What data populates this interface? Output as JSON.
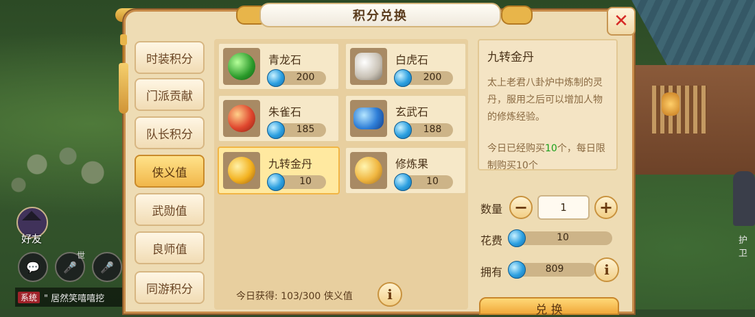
{
  "dialog": {
    "title": "积分兑换"
  },
  "tabs": [
    {
      "label": "时装积分",
      "active": false
    },
    {
      "label": "门派贡献",
      "active": false
    },
    {
      "label": "队长积分",
      "active": false
    },
    {
      "label": "侠义值",
      "active": true
    },
    {
      "label": "武勋值",
      "active": false
    },
    {
      "label": "良师值",
      "active": false
    },
    {
      "label": "同游积分",
      "active": false
    }
  ],
  "items": [
    {
      "name": "青龙石",
      "price": "200",
      "icon": "green-dragon-stone-icon",
      "selected": false
    },
    {
      "name": "白虎石",
      "price": "200",
      "icon": "white-tiger-stone-icon",
      "selected": false
    },
    {
      "name": "朱雀石",
      "price": "185",
      "icon": "vermilion-bird-stone-icon",
      "selected": false
    },
    {
      "name": "玄武石",
      "price": "188",
      "icon": "black-tortoise-stone-icon",
      "selected": false
    },
    {
      "name": "九转金丹",
      "price": "10",
      "icon": "golden-pill-icon",
      "selected": true
    },
    {
      "name": "修炼果",
      "price": "10",
      "icon": "cultivation-fruit-icon",
      "selected": false
    }
  ],
  "today": {
    "label": "今日获得:",
    "value": "103/300",
    "unit": "侠义值"
  },
  "detail": {
    "title": "九转金丹",
    "description": "太上老君八卦炉中炼制的灵丹，服用之后可以增加人物的修炼经验。",
    "limit_prefix": "今日已经购买",
    "limit_count": "10",
    "limit_suffix": "个，每日限制购买10个"
  },
  "purchase": {
    "quantity_label": "数量",
    "quantity": "1",
    "minus": "−",
    "plus": "+",
    "cost_label": "花费",
    "cost": "10",
    "owned_label": "拥有",
    "owned": "809",
    "exchange_label": "兑 换"
  },
  "hud": {
    "friend_label": "好友",
    "world_label": "世",
    "chat_tag": "系统",
    "chat_text": "\" 居然笑嘻嘻挖",
    "npc_name": "护卫"
  },
  "close": "✕",
  "info_glyph": "i"
}
